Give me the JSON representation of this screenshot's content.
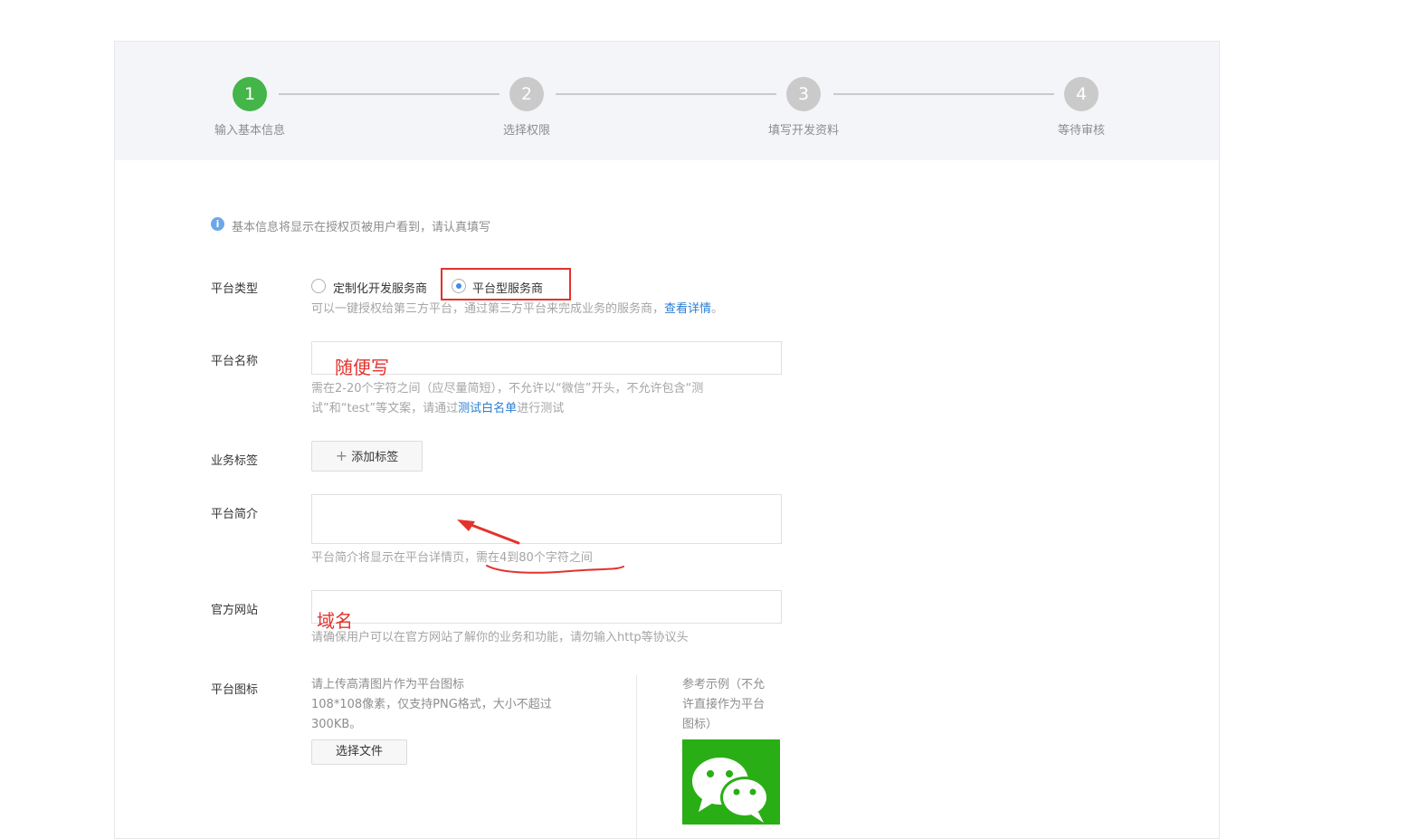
{
  "steps": [
    {
      "number": "1",
      "label": "输入基本信息",
      "active": true
    },
    {
      "number": "2",
      "label": "选择权限",
      "active": false
    },
    {
      "number": "3",
      "label": "填写开发资料",
      "active": false
    },
    {
      "number": "4",
      "label": "等待审核",
      "active": false
    }
  ],
  "info": {
    "icon": "info-icon",
    "glyph": "i",
    "text": "基本信息将显示在授权页被用户看到，请认真填写"
  },
  "platform_type": {
    "label": "平台类型",
    "options": [
      {
        "label": "定制化开发服务商",
        "checked": false
      },
      {
        "label": "平台型服务商",
        "checked": true
      }
    ],
    "hint": "可以一键授权给第三方平台，通过第三方平台来完成业务的服务商，",
    "hint_link": "查看详情",
    "hint_end": "。"
  },
  "platform_name": {
    "label": "平台名称",
    "value": "",
    "hint_line1": "需在2-20个字符之间（应尽量简短），不允许以“微信”开头，不允许包含“测",
    "hint_line2_pre": "试”和“test”等文案，请通过",
    "hint_link": "测试白名单",
    "hint_line2_post": "进行测试"
  },
  "business_tags": {
    "label": "业务标签",
    "button_icon": "plus-icon",
    "button_glyph": "+",
    "button_label": "添加标签"
  },
  "platform_intro": {
    "label": "平台简介",
    "value": "",
    "hint_pre": "平台简介将显示在平台详情页，",
    "hint_underlined": "需在4到80个字符之间"
  },
  "official_site": {
    "label": "官方网站",
    "value": "",
    "hint": "请确保用户可以在官方网站了解你的业务和功能，请勿输入http等协议头"
  },
  "platform_icon": {
    "label": "平台图标",
    "hint_lines": [
      "请上传高清图片作为平台图标",
      "108*108像素，仅支持PNG格式，大小不超过",
      "300KB。"
    ],
    "button_label": "选择文件",
    "example_lines": [
      "参考示例（不允",
      "许直接作为平台",
      "图标）"
    ],
    "example_icon": "wechat-logo-icon"
  },
  "annotations": {
    "name_note": "随便写",
    "site_note": "域名",
    "color": "#e3322d"
  },
  "colors": {
    "active": "#44b549",
    "pending": "#cacaca",
    "link": "#2a7ed3",
    "wechat_green": "#2aae16"
  }
}
